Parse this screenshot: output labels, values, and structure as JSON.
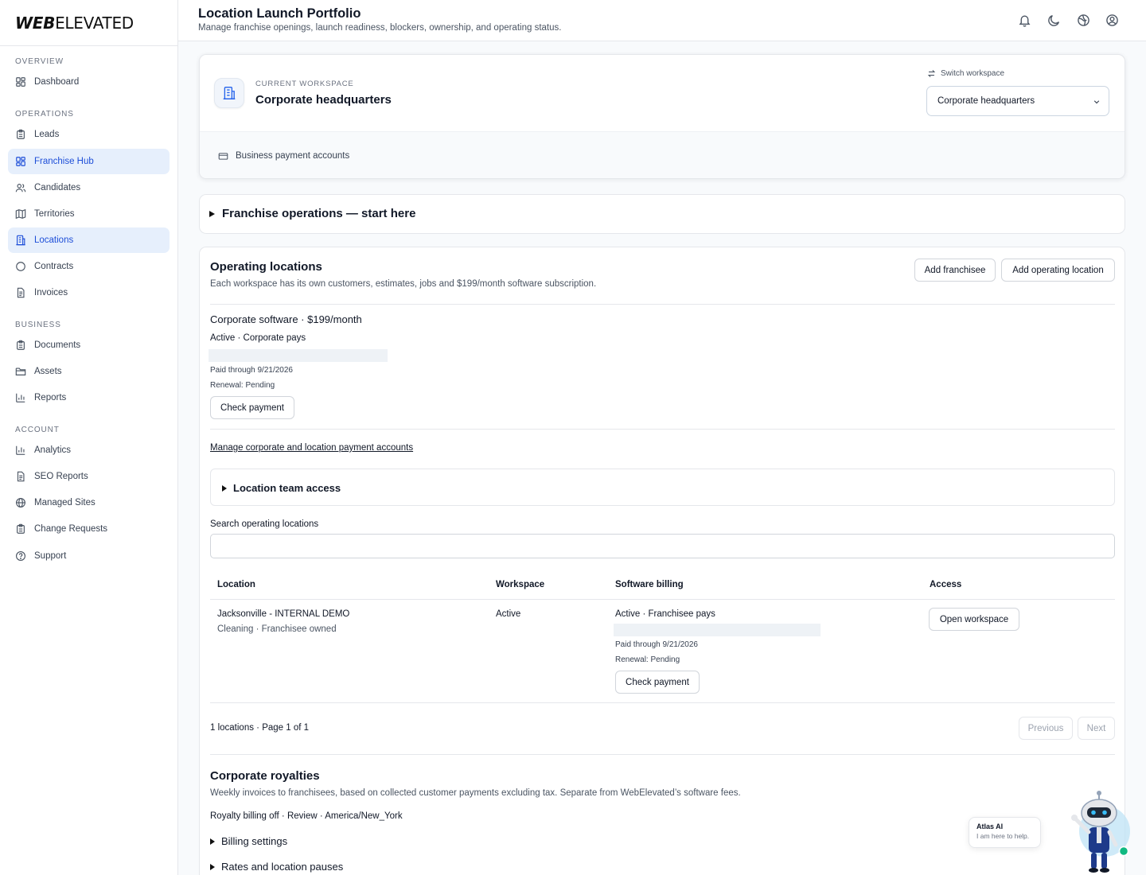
{
  "brand": {
    "logo_bold": "WEB",
    "logo_light": "ELEVATED"
  },
  "sidebar": {
    "sections": {
      "overview": "OVERVIEW",
      "operations": "OPERATIONS",
      "business": "BUSINESS",
      "account": "ACCOUNT"
    },
    "items": [
      {
        "label": "Dashboard",
        "icon": "grid-icon"
      },
      {
        "label": "Leads",
        "icon": "clipboard-icon"
      },
      {
        "label": "Franchise Hub",
        "icon": "grid-icon",
        "active": true
      },
      {
        "label": "Candidates",
        "icon": "users-icon"
      },
      {
        "label": "Territories",
        "icon": "map-icon"
      },
      {
        "label": "Locations",
        "icon": "building-icon",
        "active": true
      },
      {
        "label": "Contracts",
        "icon": "circle-icon"
      },
      {
        "label": "Invoices",
        "icon": "document-icon"
      },
      {
        "label": "Documents",
        "icon": "clipboard-icon"
      },
      {
        "label": "Assets",
        "icon": "folder-icon"
      },
      {
        "label": "Reports",
        "icon": "bar-chart-icon"
      },
      {
        "label": "Analytics",
        "icon": "bar-chart-icon"
      },
      {
        "label": "SEO Reports",
        "icon": "document-icon"
      },
      {
        "label": "Managed Sites",
        "icon": "globe-icon"
      },
      {
        "label": "Change Requests",
        "icon": "clipboard-icon"
      },
      {
        "label": "Support",
        "icon": "help-circle-icon"
      }
    ]
  },
  "header": {
    "title": "Location Launch Portfolio",
    "subtitle": "Manage franchise openings, launch readiness, blockers, ownership, and operating status.",
    "icons": [
      "bell-icon",
      "moon-icon",
      "globe-icon",
      "user-circle-icon"
    ]
  },
  "workspace": {
    "label": "CURRENT WORKSPACE",
    "name": "Corporate headquarters",
    "switch_label": "Switch workspace",
    "selected": "Corporate headquarters",
    "payment_accounts": "Business payment accounts"
  },
  "franchise_ops": {
    "summary": "Franchise operations — start here"
  },
  "operating_locations": {
    "title": "Operating locations",
    "description": "Each workspace has its own customers, estimates, jobs and $199/month software subscription.",
    "add_franchisee": "Add franchisee",
    "add_location": "Add operating location",
    "corporate_software": {
      "title": "Corporate software · $199/month",
      "status": "Active · Corporate pays",
      "paid_through": "Paid through 9/21/2026",
      "renewal": "Renewal: Pending",
      "check_payment": "Check payment"
    },
    "manage_link": "Manage corporate and location payment accounts",
    "team_access": "Location team access",
    "search_label": "Search operating locations",
    "search_placeholder": "",
    "table": {
      "headers": [
        "Location",
        "Workspace",
        "Software billing",
        "Access"
      ],
      "rows": [
        {
          "location": "Jacksonville - INTERNAL DEMO",
          "location_sub": "Cleaning · Franchisee owned",
          "workspace": "Active",
          "billing_status": "Active · Franchisee pays",
          "paid_through": "Paid through 9/21/2026",
          "renewal": "Renewal: Pending",
          "check_payment": "Check payment",
          "access_button": "Open workspace"
        }
      ]
    },
    "pagination": {
      "summary": "1 locations · Page 1 of 1",
      "previous": "Previous",
      "next": "Next"
    }
  },
  "royalties": {
    "title": "Corporate royalties",
    "description": "Weekly invoices to franchisees, based on collected customer payments excluding tax. Separate from WebElevated’s software fees.",
    "status": "Royalty billing off · Review · America/New_York",
    "billing_settings": "Billing settings",
    "rates": "Rates and location pauses"
  },
  "chat": {
    "title": "Atlas AI",
    "subtitle": "I am here to help."
  }
}
